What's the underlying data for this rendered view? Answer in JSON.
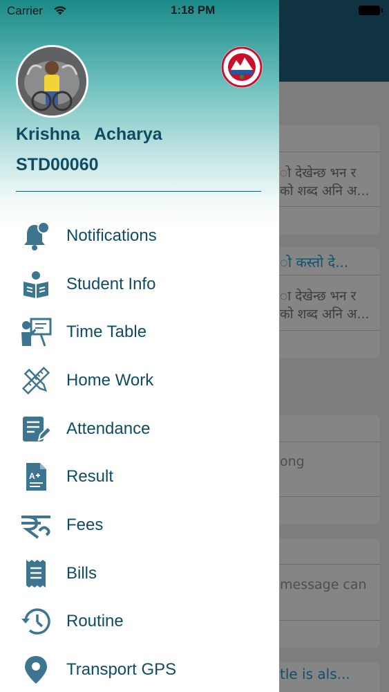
{
  "status_bar": {
    "carrier": "Carrier",
    "time": "1:18 PM"
  },
  "user": {
    "name": "Krishna   Acharya",
    "id": "STD00060"
  },
  "menu": {
    "items": [
      {
        "label": "Notifications",
        "icon": "bell-icon"
      },
      {
        "label": "Student Info",
        "icon": "student-reading-icon"
      },
      {
        "label": "Time Table",
        "icon": "teacher-board-icon"
      },
      {
        "label": "Home Work",
        "icon": "pencil-ruler-icon"
      },
      {
        "label": "Attendance",
        "icon": "document-edit-icon"
      },
      {
        "label": "Result",
        "icon": "grade-document-icon"
      },
      {
        "label": "Fees",
        "icon": "rupee-icon"
      },
      {
        "label": "Bills",
        "icon": "receipt-icon"
      },
      {
        "label": "Routine",
        "icon": "history-clock-icon"
      },
      {
        "label": "Transport GPS",
        "icon": "location-pin-icon"
      }
    ]
  },
  "background": {
    "card1_line1": "ो देखेन्छ भन र",
    "card1_line2": "को शब्द अनि अ...",
    "card2_title": "ो कस्तो दे...",
    "card2_line1": "ा देखेन्छ भन र",
    "card2_line2": "को शब्द अनि अ...",
    "card3_text": "ong",
    "card4_text": "message can",
    "card5_title": "tle is als..."
  },
  "colors": {
    "primary": "#0f4c63",
    "header_dark": "#0f3340",
    "gradient_top": "#1a8a87",
    "icon": "#3d7590"
  }
}
